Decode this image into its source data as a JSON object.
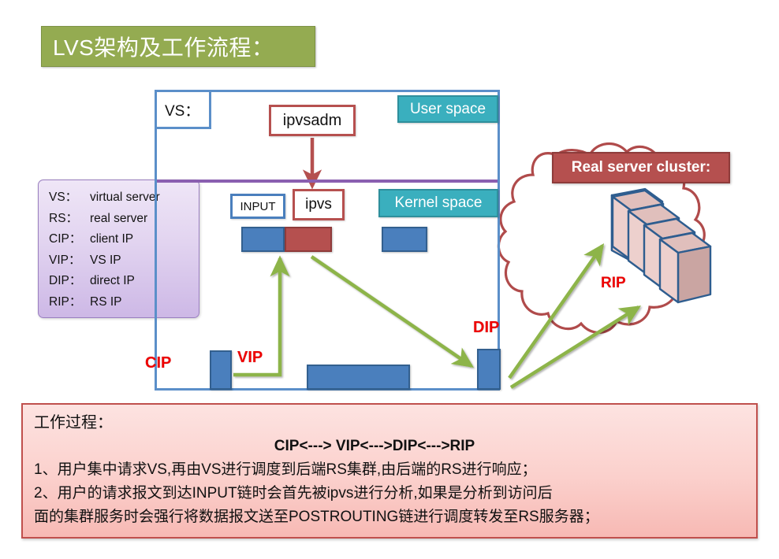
{
  "title": {
    "text": "LVS架构及工作流程："
  },
  "legend": {
    "rows": [
      {
        "key": "VS：",
        "value": "virtual server"
      },
      {
        "key": "RS：",
        "value": "real server"
      },
      {
        "key": "CIP：",
        "value": "client IP"
      },
      {
        "key": "VIP：",
        "value": "VS IP"
      },
      {
        "key": "DIP：",
        "value": "direct IP"
      },
      {
        "key": "RIP：",
        "value": "RS IP"
      }
    ]
  },
  "diagram": {
    "vs_label": "VS：",
    "user_space": "User space",
    "kernel_space": "Kernel space",
    "ipvsadm": "ipvsadm",
    "input": "INPUT",
    "ipvs": "ipvs",
    "cip": "CIP",
    "vip": "VIP",
    "dip": "DIP",
    "rip": "RIP",
    "real_server_cluster": "Real server cluster:"
  },
  "process": {
    "title": "工作过程：",
    "flow": "CIP<---> VIP<--->DIP<--->RIP",
    "lines": [
      "1、用户集中请求VS,再由VS进行调度到后端RS集群,由后端的RS进行响应；",
      "2、用户的请求报文到达INPUT链时会首先被ipvs进行分析,如果是分析到访问后",
      "面的集群服务时会强行将数据报文送至POSTROUTING链进行调度转发至RS服务器；"
    ]
  },
  "colors": {
    "title_green": "#94ab51",
    "legend_purple": "#cdb8e6",
    "frame_blue": "#5b8fc9",
    "teal": "#3aafbe",
    "red": "#b5504f",
    "arrow_green": "#8ab martial",
    "label_red": "#ee0000",
    "divider_purple": "#8a5fb0",
    "server_pink": "#e5c2bf",
    "process_pink": "#fbd0cc"
  }
}
